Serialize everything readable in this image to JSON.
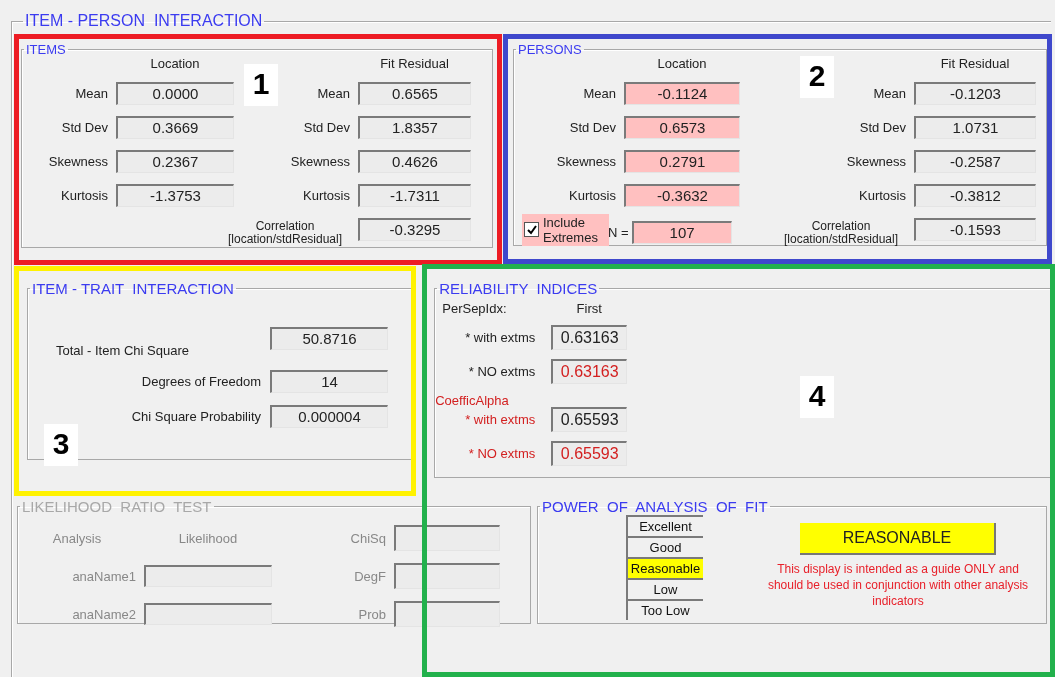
{
  "panel": {
    "title": "ITEM - PERSON  INTERACTION"
  },
  "items": {
    "title": "ITEMS",
    "columns": [
      "Location",
      "Fit Residual"
    ],
    "rows": [
      {
        "label": "Mean",
        "location": "0.0000",
        "location_highlighted": false,
        "fit_label": "Mean",
        "fit_residual": "0.6565"
      },
      {
        "label": "Std Dev",
        "location": "0.3669",
        "location_highlighted": false,
        "fit_label": "Std Dev",
        "fit_residual": "1.8357"
      },
      {
        "label": "Skewness",
        "location": "0.2367",
        "location_highlighted": false,
        "fit_label": "Skewness",
        "fit_residual": "0.4626"
      },
      {
        "label": "Kurtosis",
        "location": "-1.3753",
        "location_highlighted": false,
        "fit_label": "Kurtosis",
        "fit_residual": "-1.7311"
      }
    ],
    "correlation": {
      "label": "Correlation [location/stdResidual]",
      "value": "-0.3295"
    }
  },
  "persons": {
    "title": "PERSONS",
    "columns": [
      "Location",
      "Fit Residual"
    ],
    "rows": [
      {
        "label": "Mean",
        "location": "-0.1124",
        "location_highlighted": true,
        "fit_label": "Mean",
        "fit_residual": "-0.1203"
      },
      {
        "label": "Std Dev",
        "location": "0.6573",
        "location_highlighted": true,
        "fit_label": "Std Dev",
        "fit_residual": "1.0731"
      },
      {
        "label": "Skewness",
        "location": "0.2791",
        "location_highlighted": true,
        "fit_label": "Skewness",
        "fit_residual": "-0.2587"
      },
      {
        "label": "Kurtosis",
        "location": "-0.3632",
        "location_highlighted": true,
        "fit_label": "Kurtosis",
        "fit_residual": "-0.3812"
      }
    ],
    "include_extremes": {
      "label": "Include Extremes",
      "checked": true,
      "highlighted": true
    },
    "n": {
      "label": "N =",
      "value": "107",
      "highlighted": true
    },
    "correlation": {
      "label": "Correlation [location/stdResidual]",
      "value": "-0.1593"
    }
  },
  "trait": {
    "title": "ITEM - TRAIT  INTERACTION",
    "rows": [
      {
        "label": "Total - Item Chi Square",
        "value": "50.8716"
      },
      {
        "label": "Degrees of Freedom",
        "value": "14"
      },
      {
        "label": "Chi Square Probability",
        "value": "0.000004"
      }
    ]
  },
  "reliability": {
    "title": "RELIABILITY  INDICES",
    "column": "First",
    "groups": [
      {
        "label": "PerSepIdx:",
        "alert": false,
        "rows": [
          {
            "label": "* with extms",
            "label_alert": false,
            "value": "0.63163",
            "value_alert": false
          },
          {
            "label": "* NO extms",
            "label_alert": false,
            "value": "0.63163",
            "value_alert": true
          }
        ]
      },
      {
        "label": "CoefficAlpha",
        "alert": true,
        "rows": [
          {
            "label": "* with extms",
            "label_alert": true,
            "value": "0.65593",
            "value_alert": false
          },
          {
            "label": "* NO extms",
            "label_alert": true,
            "value": "0.65593",
            "value_alert": true
          }
        ]
      }
    ]
  },
  "likelihood": {
    "title": "LIKELIHOOD  RATIO  TEST",
    "disabled": true,
    "columns": [
      "Analysis",
      "Likelihood"
    ],
    "analyses": [
      {
        "label": "anaName1"
      },
      {
        "label": "anaName2"
      }
    ],
    "stats": [
      {
        "label": "ChiSq"
      },
      {
        "label": "DegF"
      },
      {
        "label": "Prob"
      }
    ]
  },
  "power": {
    "title": "POWER  OF  ANALYSIS  OF  FIT",
    "levels": [
      {
        "label": "Excellent",
        "selected": false
      },
      {
        "label": "Good",
        "selected": false
      },
      {
        "label": "Reasonable",
        "selected": true
      },
      {
        "label": "Low",
        "selected": false
      },
      {
        "label": "Too Low",
        "selected": false
      }
    ],
    "result": "REASONABLE",
    "note": "This display is intended as a guide ONLY and should be used in conjunction with other analysis indicators"
  },
  "annotations": [
    {
      "label": "1",
      "color": "#ed1c24"
    },
    {
      "label": "2",
      "color": "#3f48cc"
    },
    {
      "label": "3",
      "color": "#fff200"
    },
    {
      "label": "4",
      "color": "#22b14c"
    }
  ]
}
